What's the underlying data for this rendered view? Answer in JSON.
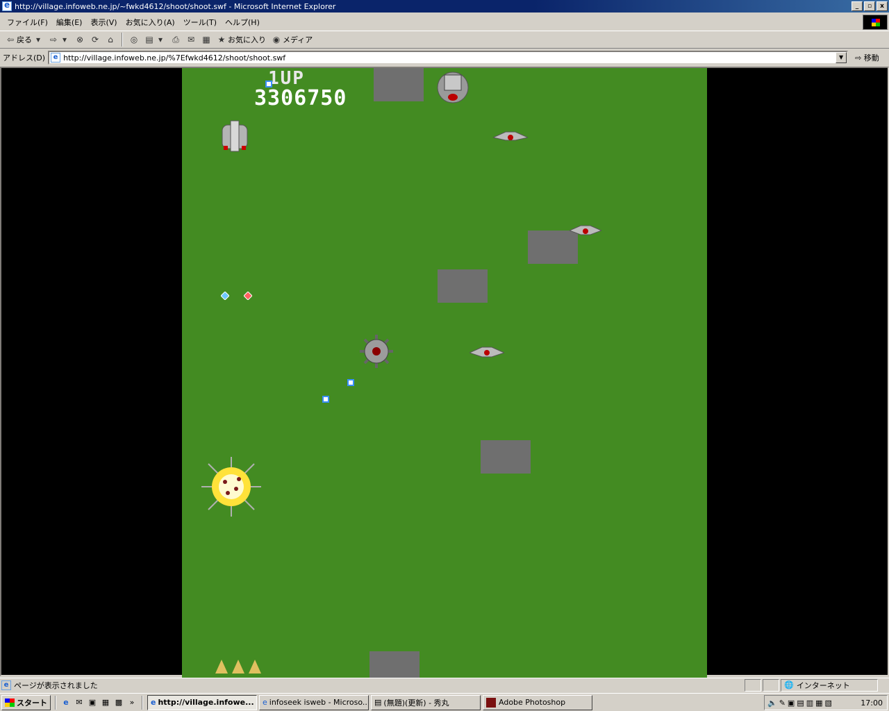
{
  "window": {
    "title": "http://village.infoweb.ne.jp/~fwkd4612/shoot/shoot.swf - Microsoft Internet Explorer",
    "controls": [
      "_",
      "▫",
      "x"
    ]
  },
  "menu": [
    "ファイル(F)",
    "編集(E)",
    "表示(V)",
    "お気に入り(A)",
    "ツール(T)",
    "ヘルプ(H)"
  ],
  "toolbar": {
    "back": "戻る",
    "favorites": "お気に入り",
    "media": "メディア"
  },
  "address": {
    "label": "アドレス(D)",
    "url": "http://village.infoweb.ne.jp/%7Efwkd4612/shoot/shoot.swf",
    "go": "移動"
  },
  "game": {
    "player_label": "1UP",
    "score": "3306750",
    "lives": 3
  },
  "status": {
    "text": "ページが表示されました",
    "zone": "インターネット"
  },
  "taskbar": {
    "start": "スタート",
    "tasks": [
      "http://village.infowe...",
      "infoseek isweb - Microso...",
      "(無題)(更新) - 秀丸",
      "Adobe Photoshop"
    ],
    "clock": "17:00"
  },
  "colors": {
    "titlebar": "#0a246a",
    "game_ground": "#438b22",
    "block": "#6f6f6f"
  }
}
